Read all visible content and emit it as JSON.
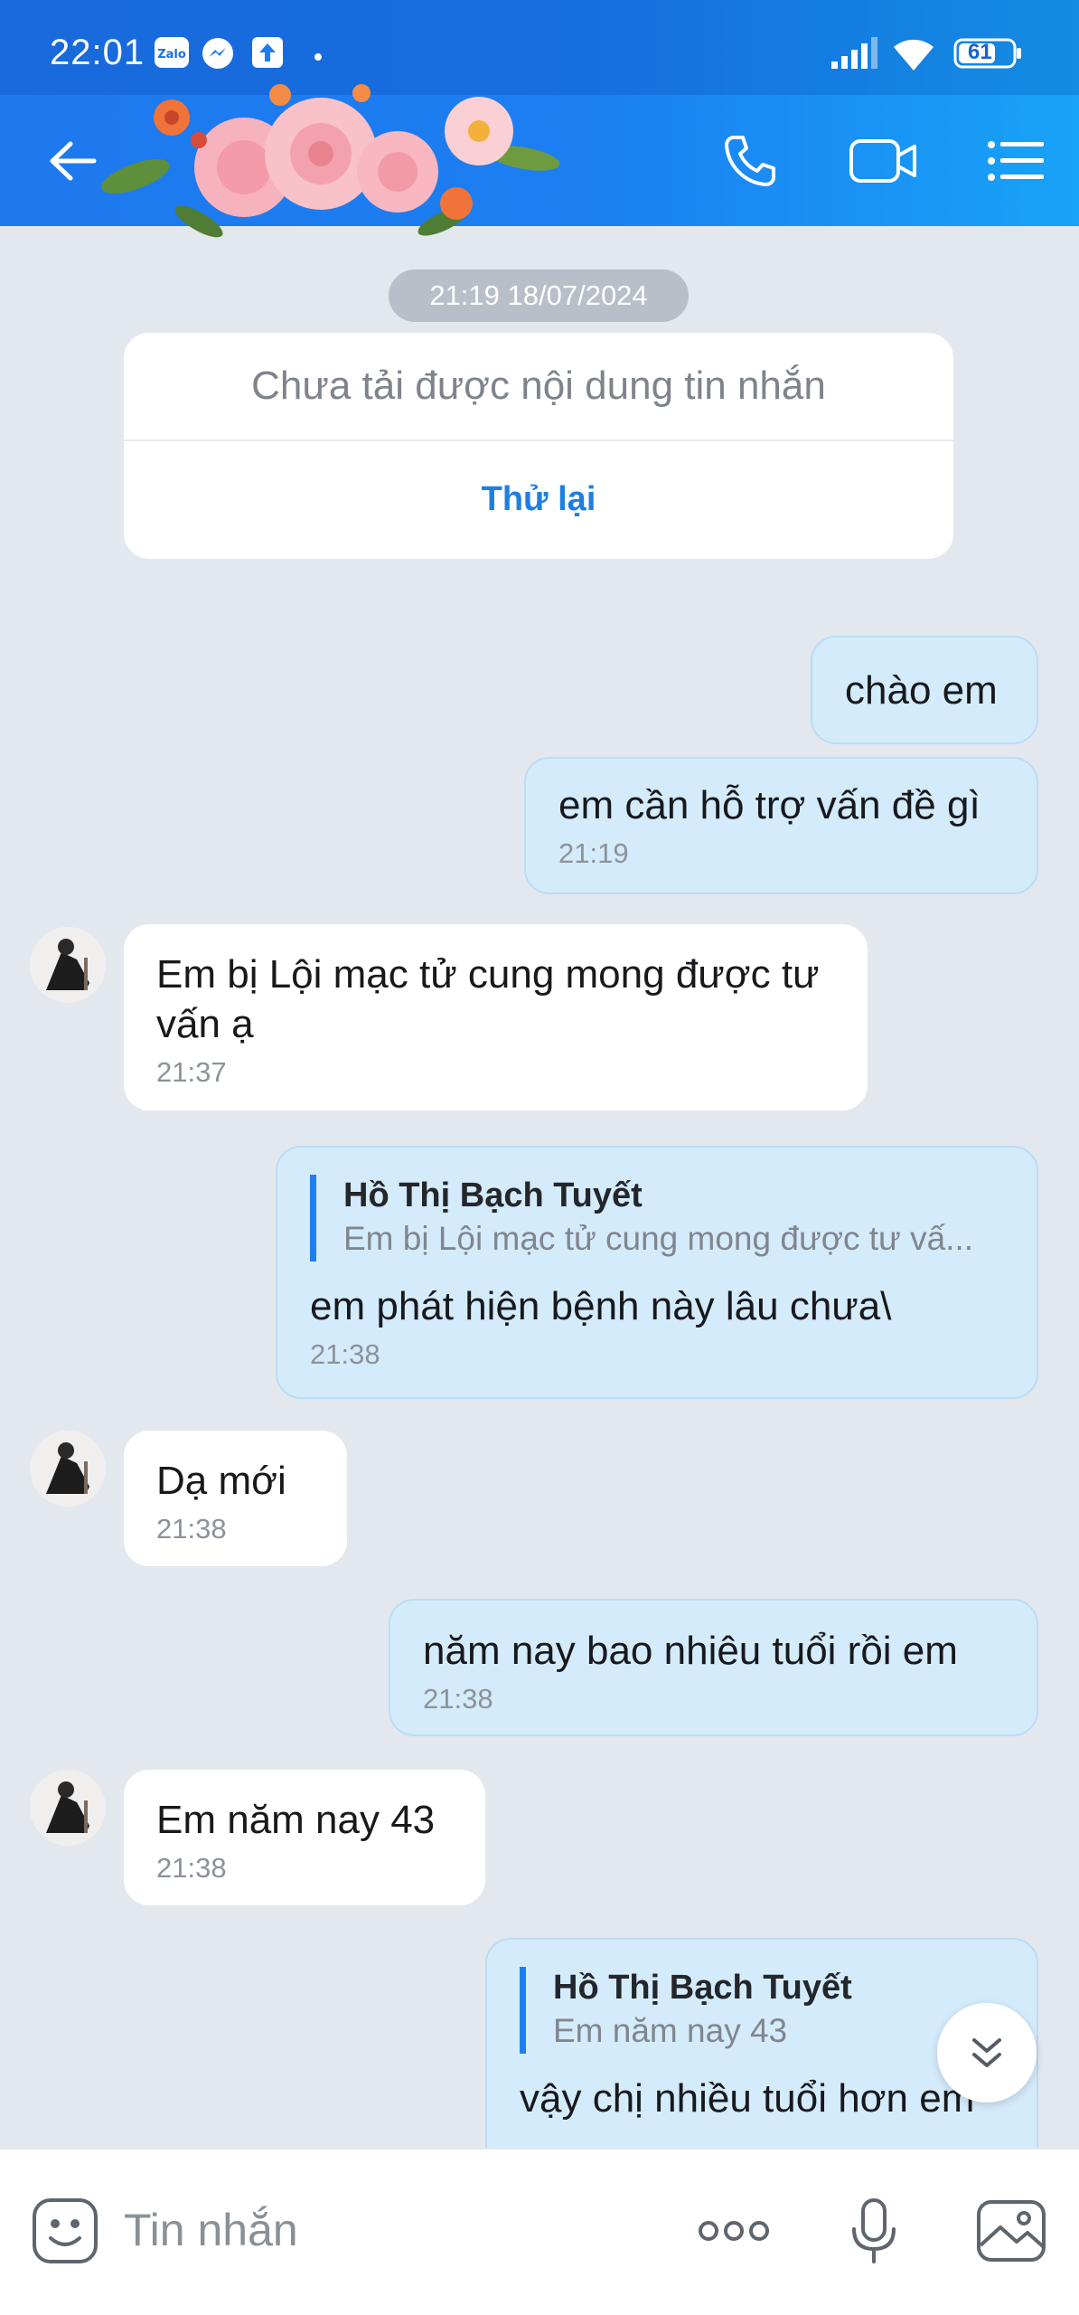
{
  "status_bar": {
    "time": "22:01",
    "notifications": [
      "zalo-icon",
      "messenger-icon",
      "upload-icon",
      "dot"
    ],
    "battery": "61"
  },
  "header": {
    "back_icon": "arrow-left-icon",
    "actions": [
      "phone-icon",
      "video-call-icon",
      "list-menu-icon"
    ]
  },
  "chat": {
    "date_chip": "21:19 18/07/2024",
    "error_card": {
      "message": "Chưa tải được nội dung tin nhắn",
      "retry": "Thử lại"
    },
    "messages": [
      {
        "direction": "out",
        "text": "chào em",
        "time": ""
      },
      {
        "direction": "out",
        "text": "em cần hỗ trợ vấn đề gì",
        "time": "21:19"
      },
      {
        "direction": "in",
        "text": "Em bị Lội mạc tử cung mong được tư vấn ạ",
        "time": "21:37"
      },
      {
        "direction": "out",
        "quote_name": "Hồ Thị Bạch Tuyết",
        "quote_text": "Em bị Lội mạc tử cung mong được tư vấ...",
        "text": "em phát hiện bệnh này lâu chưa\\",
        "time": "21:38"
      },
      {
        "direction": "in",
        "text": "Dạ mới",
        "time": "21:38"
      },
      {
        "direction": "out",
        "text": "năm nay bao nhiêu tuổi rồi em",
        "time": "21:38"
      },
      {
        "direction": "in",
        "text": "Em năm nay 43",
        "time": "21:38"
      },
      {
        "direction": "out",
        "quote_name": "Hồ Thị Bạch Tuyết",
        "quote_text": "Em năm nay 43",
        "text": "vậy chị nhiều tuổi hơn em",
        "time": ""
      }
    ]
  },
  "composer": {
    "placeholder": "Tin nhắn",
    "icons": [
      "sticker-icon",
      "more-icon",
      "microphone-icon",
      "image-icon"
    ]
  },
  "colors": {
    "header_blue": "#1b7ff2",
    "outgoing_bubble": "#d4ebfc",
    "incoming_bubble": "#ffffff",
    "chat_background": "#e3e7ee",
    "accent": "#1f7fe0"
  }
}
